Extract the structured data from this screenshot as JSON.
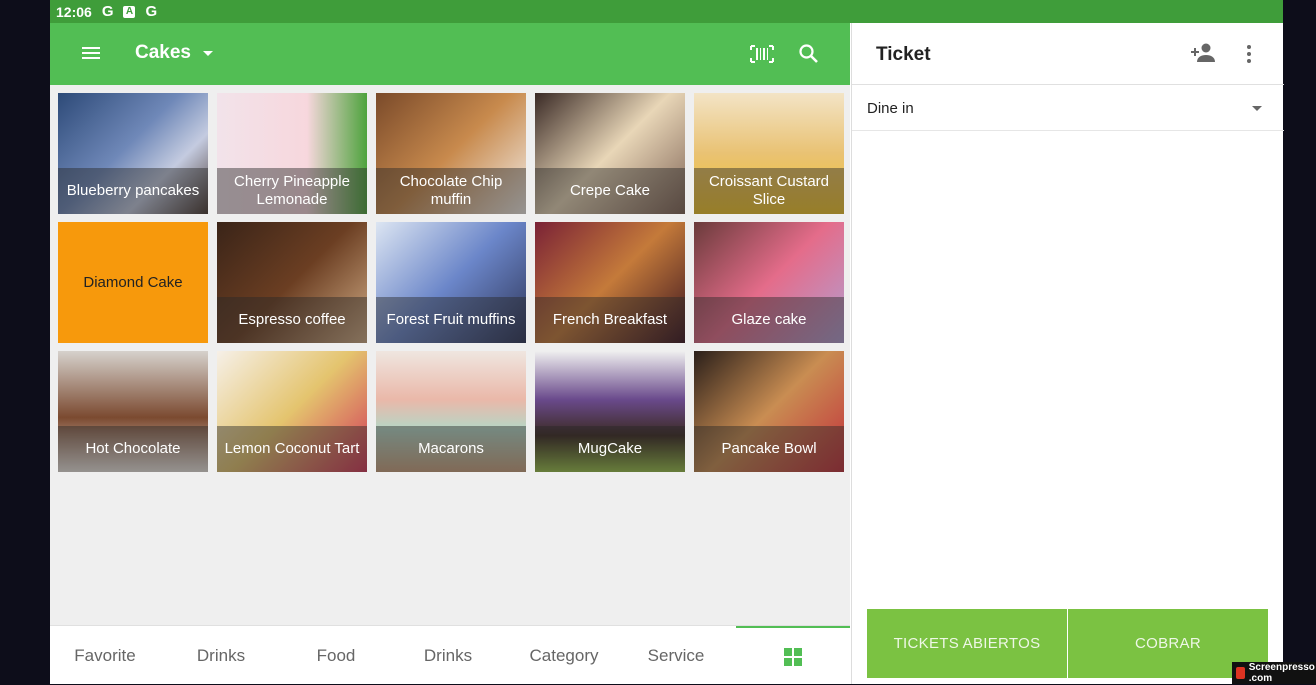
{
  "status_bar": {
    "time": "12:06",
    "icons": [
      "G",
      "A",
      "G"
    ]
  },
  "header": {
    "category_title": "Cakes"
  },
  "products": [
    {
      "name": "Blueberry pancakes",
      "bg": "linear-gradient(135deg,#2d4a78,#6f88b8 45%,#c4cbe0 70%,#4a3a33)"
    },
    {
      "name": "Cherry Pineapple Lemonade",
      "bg": "linear-gradient(90deg,#f2e3ea,#f7d7dd 60%,#4ea33d)"
    },
    {
      "name": "Chocolate Chip muffin",
      "bg": "linear-gradient(135deg,#7a4a2a,#c88a4d 50%,#f2ede8)"
    },
    {
      "name": "Crepe Cake",
      "bg": "linear-gradient(135deg,#3a2a26,#e8d6b7 50%,#806456)"
    },
    {
      "name": "Croissant Custard Slice",
      "bg": "linear-gradient(180deg,#f3e4c6,#e9c273 50%,#f3c52a)"
    },
    {
      "name": "Diamond Cake",
      "bg": "#f7990c",
      "plain": true
    },
    {
      "name": "Espresso coffee",
      "bg": "linear-gradient(135deg,#3a2418,#6b3e22 50%,#d2ad86)"
    },
    {
      "name": "Forest Fruit muffins",
      "bg": "linear-gradient(135deg,#dce5f2,#6b86c9 50%,#2e3558)"
    },
    {
      "name": "French Breakfast",
      "bg": "linear-gradient(135deg,#7a2236,#c47a3a 50%,#3b1420)"
    },
    {
      "name": "Glaze cake",
      "bg": "linear-gradient(135deg,#6a3b3b,#e46c8a 50%,#b29fd2)"
    },
    {
      "name": "Hot Chocolate",
      "bg": "linear-gradient(180deg,#d6d1cc,#7b4a30 55%,#efe9e4)"
    },
    {
      "name": "Lemon Coconut Tart",
      "bg": "linear-gradient(135deg,#f6f0e8,#e4c46e 50%,#d13658)"
    },
    {
      "name": "Macarons",
      "bg": "linear-gradient(180deg,#efe6e0,#eab8a9 40%,#b6d6c6 65%,#c9a07d)"
    },
    {
      "name": "MugCake",
      "bg": "linear-gradient(180deg,#efefef,#6a4a8c 40%,#3b2a22 70%,#9bc24b)"
    },
    {
      "name": "Pancake Bowl",
      "bg": "linear-gradient(135deg,#2a1f1a,#c98d52 50%,#c22f3b)"
    }
  ],
  "bottom_nav": [
    "Favorite",
    "Drinks",
    "Food",
    "Drinks",
    "Category",
    "Service"
  ],
  "ticket": {
    "title": "Ticket",
    "dining_option": "Dine in",
    "open_tickets_label": "TICKETS ABIERTOS",
    "charge_label": "COBRAR"
  },
  "watermark": "Screenpresso .com",
  "colors": {
    "primary": "#52be54",
    "status_bar": "#3f9d3a",
    "button": "#7bc242",
    "highlight_tile": "#f7990c"
  }
}
